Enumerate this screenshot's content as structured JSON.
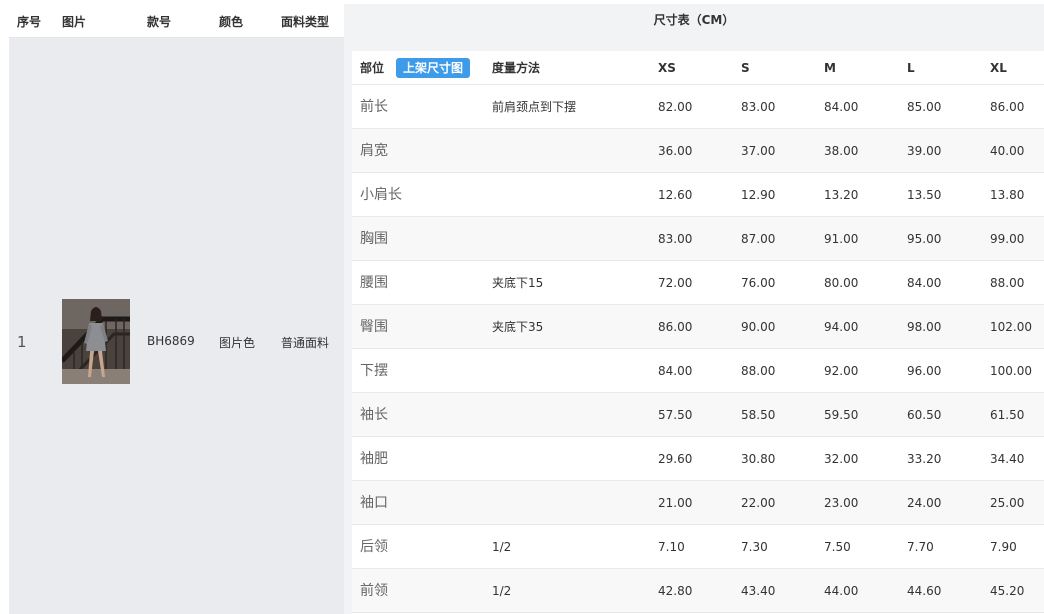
{
  "left_table": {
    "headers": {
      "index": "序号",
      "image": "图片",
      "style_no": "款号",
      "color": "颜色",
      "fabric": "面料类型"
    },
    "row": {
      "index": "1",
      "style_no": "BH6869",
      "color": "图片色",
      "fabric": "普通面料"
    }
  },
  "size_table": {
    "title": "尺寸表（CM）",
    "headers": {
      "part": "部位",
      "method": "度量方法",
      "xs": "XS",
      "s": "S",
      "m": "M",
      "l": "L",
      "xl": "XL"
    },
    "upload_button": "上架尺寸图",
    "rows": [
      {
        "part": "前长",
        "method": "前肩颈点到下摆",
        "xs": "82.00",
        "s": "83.00",
        "m": "84.00",
        "l": "85.00",
        "xl": "86.00"
      },
      {
        "part": "肩宽",
        "method": "",
        "xs": "36.00",
        "s": "37.00",
        "m": "38.00",
        "l": "39.00",
        "xl": "40.00"
      },
      {
        "part": "小肩长",
        "method": "",
        "xs": "12.60",
        "s": "12.90",
        "m": "13.20",
        "l": "13.50",
        "xl": "13.80"
      },
      {
        "part": "胸围",
        "method": "",
        "xs": "83.00",
        "s": "87.00",
        "m": "91.00",
        "l": "95.00",
        "xl": "99.00"
      },
      {
        "part": "腰围",
        "method": "夹底下15",
        "xs": "72.00",
        "s": "76.00",
        "m": "80.00",
        "l": "84.00",
        "xl": "88.00"
      },
      {
        "part": "臀围",
        "method": "夹底下35",
        "xs": "86.00",
        "s": "90.00",
        "m": "94.00",
        "l": "98.00",
        "xl": "102.00"
      },
      {
        "part": "下摆",
        "method": "",
        "xs": "84.00",
        "s": "88.00",
        "m": "92.00",
        "l": "96.00",
        "xl": "100.00"
      },
      {
        "part": "袖长",
        "method": "",
        "xs": "57.50",
        "s": "58.50",
        "m": "59.50",
        "l": "60.50",
        "xl": "61.50"
      },
      {
        "part": "袖肥",
        "method": "",
        "xs": "29.60",
        "s": "30.80",
        "m": "32.00",
        "l": "33.20",
        "xl": "34.40"
      },
      {
        "part": "袖口",
        "method": "",
        "xs": "21.00",
        "s": "22.00",
        "m": "23.00",
        "l": "24.00",
        "xl": "25.00"
      },
      {
        "part": "后领",
        "method": "1/2",
        "xs": "7.10",
        "s": "7.30",
        "m": "7.50",
        "l": "7.70",
        "xl": "7.90"
      },
      {
        "part": "前领",
        "method": "1/2",
        "xs": "42.80",
        "s": "43.40",
        "m": "44.00",
        "l": "44.60",
        "xl": "45.20"
      }
    ]
  },
  "colors": {
    "accent": "#3d9be9",
    "left_body_bg": "#e9ebee",
    "header_bg": "#f2f3f5"
  }
}
